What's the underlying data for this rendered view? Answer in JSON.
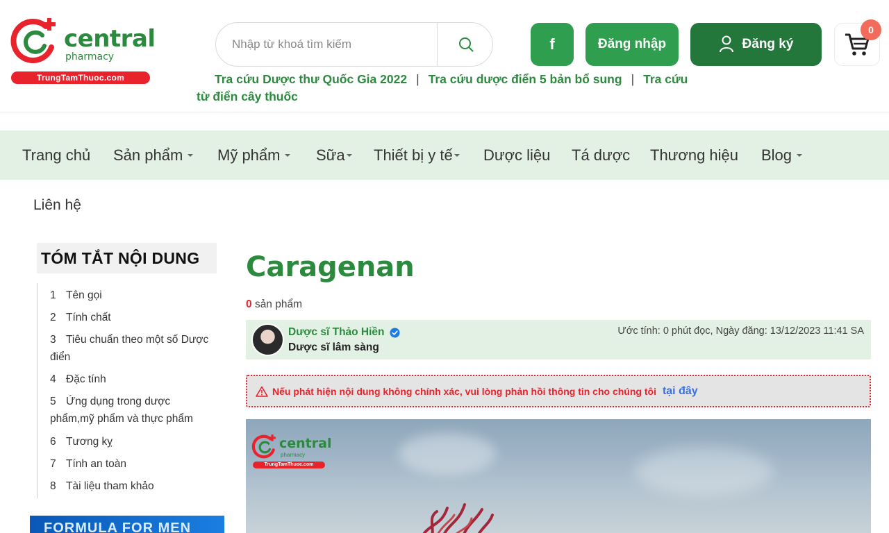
{
  "header": {
    "logo": {
      "brand": "central",
      "sub": "pharmacy",
      "ribbon": "TrungTamThuoc.com"
    },
    "search": {
      "placeholder": "Nhập từ khoá tìm kiếm"
    },
    "buttons": {
      "facebook": "f",
      "login": "Đăng nhập",
      "register": "Đăng ký"
    },
    "cart_count": "0",
    "quick_links": [
      "Tra cứu Dược thư Quốc Gia 2022",
      "Tra cứu dược điển 5 bản bổ sung",
      "Tra cứu từ điển cây thuốc"
    ],
    "quick_links_sep": "|"
  },
  "nav": {
    "items": [
      {
        "label": "Trang chủ"
      },
      {
        "label": "Sản phẩm"
      },
      {
        "label": "Mỹ phẩm"
      },
      {
        "label": "Sữa"
      },
      {
        "label": "Thiết bị y tế"
      },
      {
        "label": "Dược liệu"
      },
      {
        "label": "Tá dược"
      },
      {
        "label": "Thương hiệu"
      },
      {
        "label": "Blog"
      }
    ]
  },
  "breadcrumb": "Liên hệ",
  "toc": {
    "title": "TÓM TẮT NỘI DUNG",
    "items": [
      {
        "num": "1",
        "label": "Tên gọi"
      },
      {
        "num": "2",
        "label": "Tính chất"
      },
      {
        "num": "3",
        "label": "Tiêu chuẩn theo một số Dược điển"
      },
      {
        "num": "4",
        "label": "Đặc tính"
      },
      {
        "num": "5",
        "label": "Ứng dụng trong dược phẩm,mỹ phẩm và thực phẩm"
      },
      {
        "num": "6",
        "label": "Tương kỵ"
      },
      {
        "num": "7",
        "label": "Tính an toàn"
      },
      {
        "num": "8",
        "label": "Tài liệu tham khảo"
      }
    ]
  },
  "banner_text": "FORMULA FOR MEN",
  "article": {
    "title": "Caragenan",
    "product_count": "0",
    "product_label": "sản phẩm",
    "author_name": "Dược sĩ Thảo Hiền",
    "author_role": "Dược sĩ lâm sàng",
    "meta": "Ước tính: 0 phút đọc, Ngày đăng: 13/12/2023 11:41 SA",
    "alert_text": "Nếu phát hiện nội dung không chính xác, vui lòng phản hồi thông tin cho chúng tôi",
    "alert_link": "tại đây"
  },
  "colors": {
    "brand_green": "#2b8a3e",
    "button_green": "#2f9e4f",
    "dark_green": "#24773b",
    "nav_bg": "#e3f1e4",
    "alert_red": "#e8232b",
    "link_blue": "#3a6fe0"
  }
}
